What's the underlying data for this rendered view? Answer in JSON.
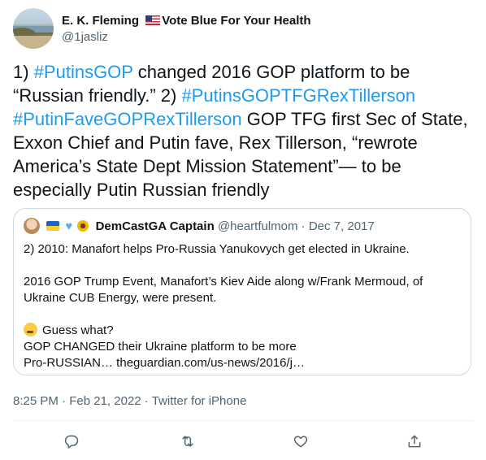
{
  "author": {
    "name": "E. K. Fleming",
    "suffix": "Vote Blue For Your Health",
    "handle": "@1jasliz"
  },
  "tweet": {
    "p1": "1) ",
    "h1": "#PutinsGOP",
    "p2": " changed 2016 GOP platform to be “Russian friendly.” 2) ",
    "h2": "#PutinsGOPTFGRexTillerson",
    "h3": "#PutinFaveGOPRexTillerson",
    "p3": " GOP TFG first Sec of State, Exxon Chief and Putin fave, Rex Tillerson, “rewrote America’s State Dept Mission Statement”— to be especially Putin Russian friendly"
  },
  "quoted": {
    "name": "DemCastGA Captain",
    "handle": "@heartfulmom",
    "sep": "·",
    "date": "Dec 7, 2017",
    "line1": "2) 2010: Manafort helps Pro-Russia Yanukovych get elected in Ukraine.",
    "line2": "2016 GOP Trump Event, Manafort’s Kiev Aide along w/Frank Mermoud, of Ukraine CUB Energy, were present.",
    "line3": "Guess what?",
    "line4": "GOP CHANGED their Ukraine platform to be more",
    "line5": "Pro-RUSSIAN… theguardian.com/us-news/2016/j…"
  },
  "meta": {
    "time": "8:25 PM",
    "sep": "·",
    "date": "Feb 21, 2022",
    "source": "Twitter for iPhone"
  },
  "icons": {
    "reply": "reply-icon",
    "retweet": "retweet-icon",
    "like": "like-icon",
    "share": "share-icon"
  },
  "colors": {
    "accent": "#1d9bf0",
    "secondary": "#536471",
    "text": "#0f1419",
    "border": "#cfd9de"
  }
}
